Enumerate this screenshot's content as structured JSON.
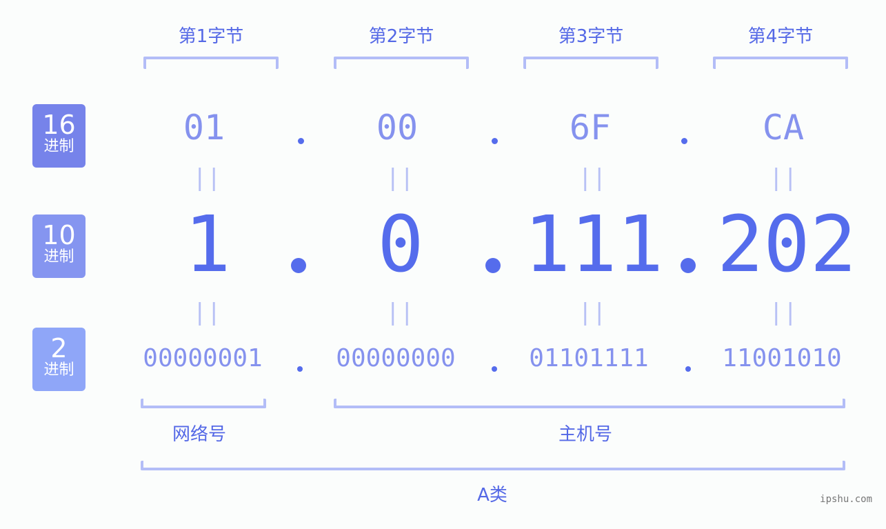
{
  "bytes": [
    {
      "label": "第1字节",
      "hex": "01",
      "dec": "1",
      "bin": "00000001"
    },
    {
      "label": "第2字节",
      "hex": "00",
      "dec": "0",
      "bin": "00000000"
    },
    {
      "label": "第3字节",
      "hex": "6F",
      "dec": "111",
      "bin": "01101111"
    },
    {
      "label": "第4字节",
      "hex": "CA",
      "dec": "202",
      "bin": "11001010"
    }
  ],
  "badges": {
    "hex": {
      "num": "16",
      "unit": "进制",
      "color": "#7683ea"
    },
    "dec": {
      "num": "10",
      "unit": "进制",
      "color": "#8595f0"
    },
    "bin": {
      "num": "2",
      "unit": "进制",
      "color": "#8fa6f8"
    }
  },
  "equals_symbol": "||",
  "network_label": "网络号",
  "host_label": "主机号",
  "class_label": "A类",
  "watermark": "ipshu.com",
  "colors": {
    "accent": "#556cec",
    "light": "#8592ee",
    "bracket": "#b3bdf7"
  }
}
